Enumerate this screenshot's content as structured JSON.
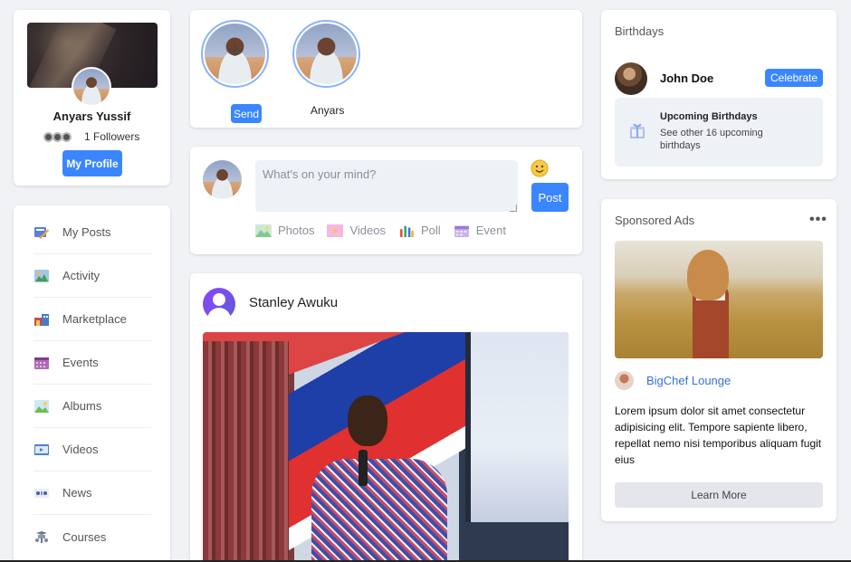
{
  "profile": {
    "name": "Anyars Yussif",
    "followers": "1 Followers",
    "button_label": "My Profile"
  },
  "nav": {
    "items": [
      {
        "label": "My Posts",
        "icon": "posts-icon"
      },
      {
        "label": "Activity",
        "icon": "activity-icon"
      },
      {
        "label": "Marketplace",
        "icon": "marketplace-icon"
      },
      {
        "label": "Events",
        "icon": "events-icon"
      },
      {
        "label": "Albums",
        "icon": "albums-icon"
      },
      {
        "label": "Videos",
        "icon": "videos-icon"
      },
      {
        "label": "News",
        "icon": "news-icon"
      },
      {
        "label": "Courses",
        "icon": "courses-icon"
      }
    ]
  },
  "stories": {
    "send_label": "Send",
    "items": [
      {
        "label": "Anyars"
      }
    ]
  },
  "composer": {
    "placeholder": "What's on your mind?",
    "post_label": "Post",
    "media": [
      {
        "label": "Photos",
        "icon": "photos-icon"
      },
      {
        "label": "Videos",
        "icon": "videos-icon"
      },
      {
        "label": "Poll",
        "icon": "poll-icon"
      },
      {
        "label": "Event",
        "icon": "event-icon"
      }
    ]
  },
  "post": {
    "author": "Stanley Awuku"
  },
  "birthdays": {
    "title": "Birthdays",
    "person": "John Doe",
    "celebrate_label": "Celebrate",
    "upcoming_title": "Upcoming Birthdays",
    "upcoming_text": "See other 16 upcoming birthdays"
  },
  "ads": {
    "title": "Sponsored Ads",
    "more": "•••",
    "brand": "BigChef Lounge",
    "text": "Lorem ipsum dolor sit amet consectetur adipisicing elit. Tempore sapiente libero, repellat nemo nisi temporibus aliquam fugit eius",
    "button_label": "Learn More"
  },
  "colors": {
    "accent": "#3a86ff",
    "background": "#f0f2f5",
    "link": "#3a6fd8"
  }
}
